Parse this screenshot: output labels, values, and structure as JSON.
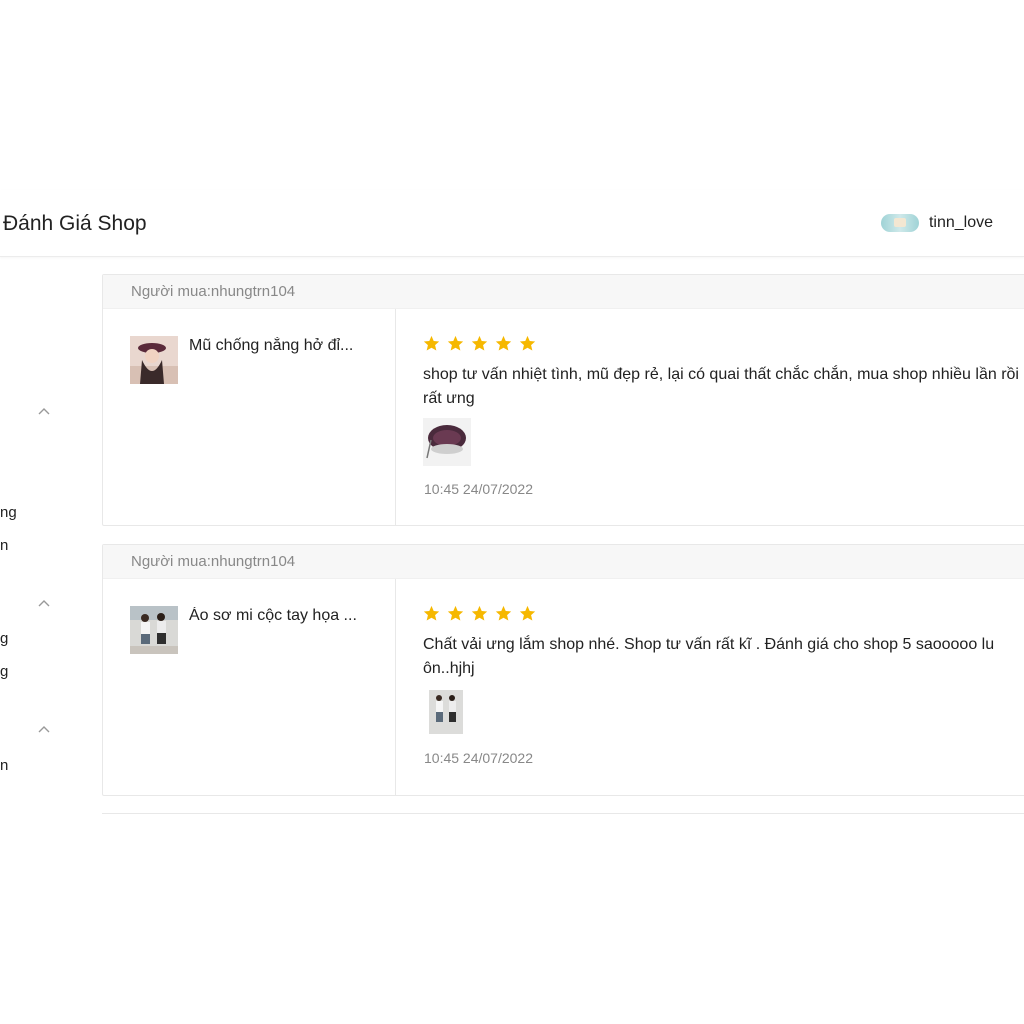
{
  "header": {
    "title": "Đánh Giá Shop",
    "user": {
      "name": "tinn_love",
      "avatar_icon": "user-avatar"
    }
  },
  "sidebar": {
    "cut_labels": [
      "ng",
      "n",
      "g",
      "g",
      "n"
    ]
  },
  "reviews": [
    {
      "buyer": "Người mua:nhungtrn104",
      "product_name": "Mũ chống nắng hở đỉ...",
      "rating": 5,
      "comment": "shop tư vấn nhiệt tình, mũ đẹp rẻ, lại có quai thất chắc chắn, mua shop nhiều lần rồi rất ưng",
      "time": "10:45 24/07/2022"
    },
    {
      "buyer": "Người mua:nhungtrn104",
      "product_name": "Áo sơ mi cộc tay họa ...",
      "rating": 5,
      "comment": "Chất vải ưng lắm shop nhé. Shop tư vấn rất kĩ . Đánh giá cho shop 5 saooooo lu ôn..hjhj",
      "time": "10:45 24/07/2022"
    }
  ],
  "colors": {
    "star": "#f6b800",
    "muted_text": "#888888",
    "border": "#e8e8e8"
  }
}
